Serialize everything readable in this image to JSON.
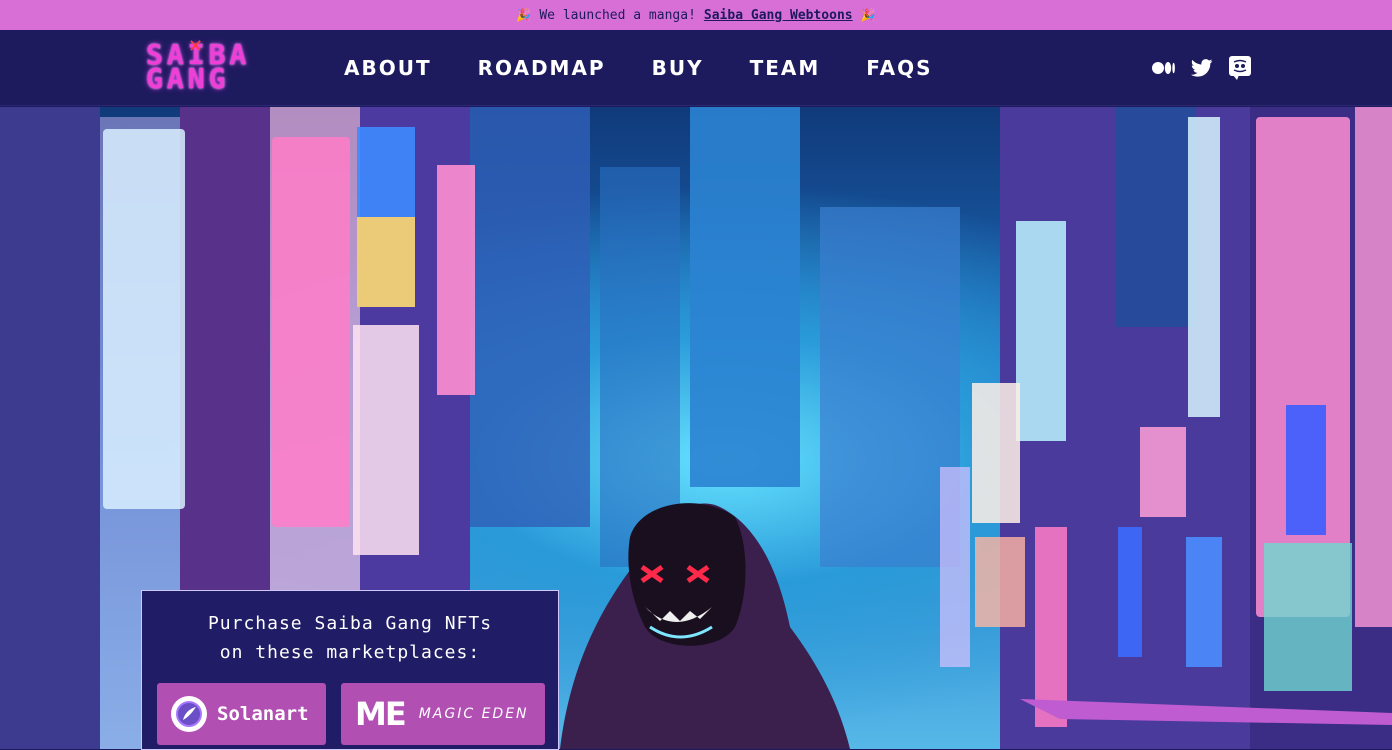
{
  "announcement": {
    "emoji_left": "🎉",
    "text": "We launched a manga!",
    "link_text": "Saiba Gang Webtoons",
    "emoji_right": "🎉"
  },
  "logo": {
    "line1": "SAIBA",
    "line2": "GANG"
  },
  "nav": {
    "items": [
      {
        "label": "ABOUT"
      },
      {
        "label": "ROADMAP"
      },
      {
        "label": "BUY"
      },
      {
        "label": "TEAM"
      },
      {
        "label": "FAQS"
      }
    ]
  },
  "socials": {
    "icons": [
      "medium-icon",
      "twitter-icon",
      "discord-icon"
    ]
  },
  "buy_box": {
    "title_line1": "Purchase Saiba Gang NFTs",
    "title_line2": "on these marketplaces:",
    "solanart_label": "Solanart",
    "magic_eden_logo": "ME",
    "magic_eden_label": "MAGIC EDEN"
  },
  "colors": {
    "announcement_bg": "#d76fd6",
    "nav_bg": "#1d1b5e",
    "logo_pink": "#f03fd6",
    "button_bg": "#b14fb3"
  }
}
